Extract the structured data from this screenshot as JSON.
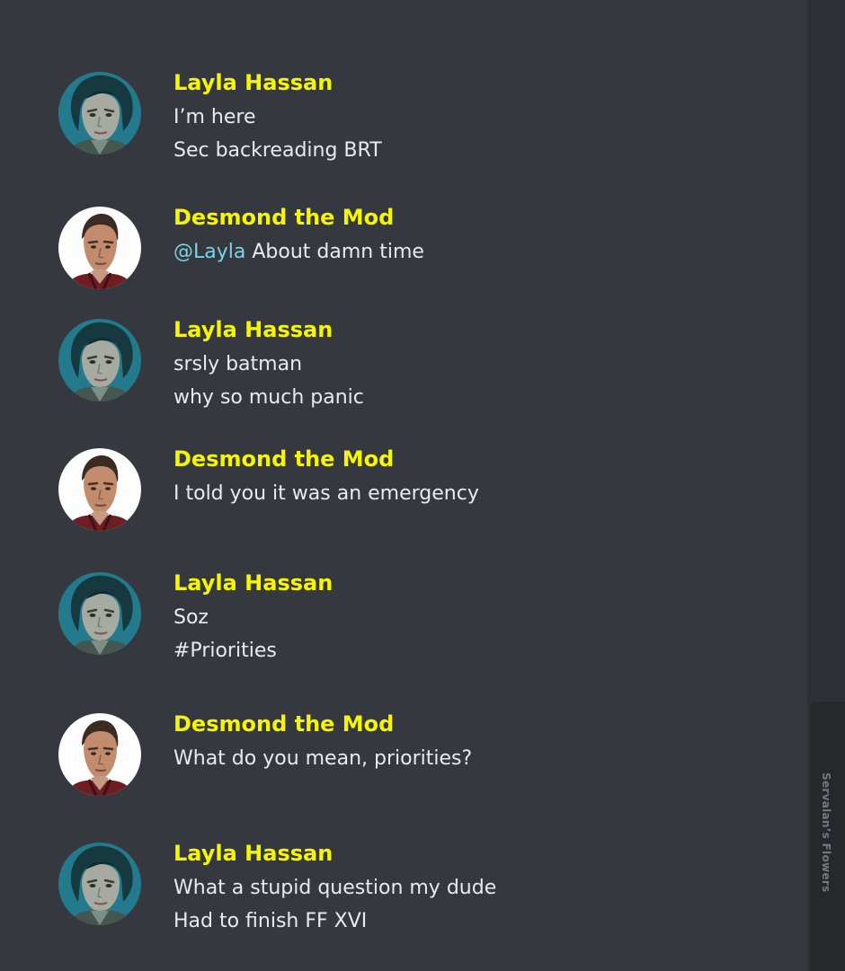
{
  "messages": [
    {
      "author": "Layla Hassan",
      "avatar": "layla-avatar",
      "lines": [
        "I’m here",
        "Sec backreading BRT"
      ]
    },
    {
      "author": "Desmond the Mod",
      "avatar": "desmond-avatar",
      "mention": "@Layla",
      "lines": [
        "About damn time"
      ]
    },
    {
      "author": "Layla Hassan",
      "avatar": "layla-avatar",
      "lines": [
        "srsly batman",
        "why so much panic"
      ]
    },
    {
      "author": "Desmond the Mod",
      "avatar": "desmond-avatar",
      "lines": [
        "I told you it was an emergency"
      ]
    },
    {
      "author": "Layla Hassan",
      "avatar": "layla-avatar",
      "lines": [
        "Soz",
        "#Priorities"
      ]
    },
    {
      "author": "Desmond the Mod",
      "avatar": "desmond-avatar",
      "lines": [
        "What do you mean, priorities?"
      ]
    },
    {
      "author": "Layla Hassan",
      "avatar": "layla-avatar",
      "lines": [
        "What a stupid question my dude",
        "Had to finish FF XVI"
      ]
    }
  ],
  "sidebar": {
    "tab_label": "Servalan’s Flowers"
  },
  "colors": {
    "background": "#36383f",
    "author_name": "#f6f600",
    "message_text": "#e9eaec",
    "mention": "#7ad3e6",
    "sidebar": "#2e3035"
  }
}
